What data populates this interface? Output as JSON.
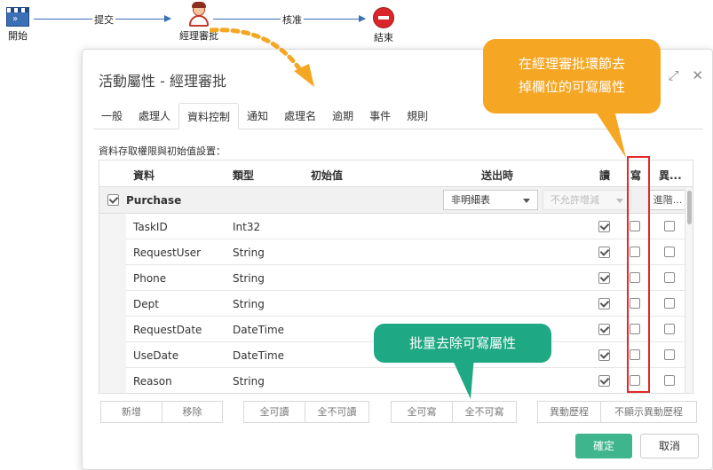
{
  "workflow": {
    "start": "開始",
    "manager": "經理審批",
    "end": "結束",
    "edge1": "提交",
    "edge2": "核准"
  },
  "dialog": {
    "title": "活動屬性 - 經理審批",
    "tabs": [
      "一般",
      "處理人",
      "資料控制",
      "通知",
      "處理名",
      "逾期",
      "事件",
      "規則"
    ],
    "active_tab": "資料控制",
    "section_label": "資料存取權限與初始值設置：",
    "columns": {
      "data": "資料",
      "type": "類型",
      "init": "初始值",
      "send": "送出時",
      "read": "讀",
      "write": "寫",
      "diff": "異..."
    },
    "group": {
      "name": "Purchase",
      "select1": "非明細表",
      "select2": "不允許增減",
      "advanced": "進階..."
    },
    "rows": [
      {
        "name": "TaskID",
        "type": "Int32"
      },
      {
        "name": "RequestUser",
        "type": "String"
      },
      {
        "name": "Phone",
        "type": "String"
      },
      {
        "name": "Dept",
        "type": "String"
      },
      {
        "name": "RequestDate",
        "type": "DateTime"
      },
      {
        "name": "UseDate",
        "type": "DateTime"
      },
      {
        "name": "Reason",
        "type": "String"
      }
    ],
    "buttons": {
      "add": "新增",
      "remove": "移除",
      "all_read": "全可讀",
      "none_read": "全不可讀",
      "all_write": "全可寫",
      "none_write": "全不可寫",
      "diff_history": "異動歷程",
      "hide_diff": "不顯示異動歷程",
      "ok": "確定",
      "cancel": "取消"
    }
  },
  "callouts": {
    "top_line1": "在經理審批環節去",
    "top_line2": "掉欄位的可寫屬性",
    "bottom": "批量去除可寫屬性"
  },
  "colors": {
    "callout_orange": "#f5a623",
    "callout_green": "#1ea883",
    "ok_green": "#3fb58d",
    "highlight_red": "#e0292b"
  }
}
